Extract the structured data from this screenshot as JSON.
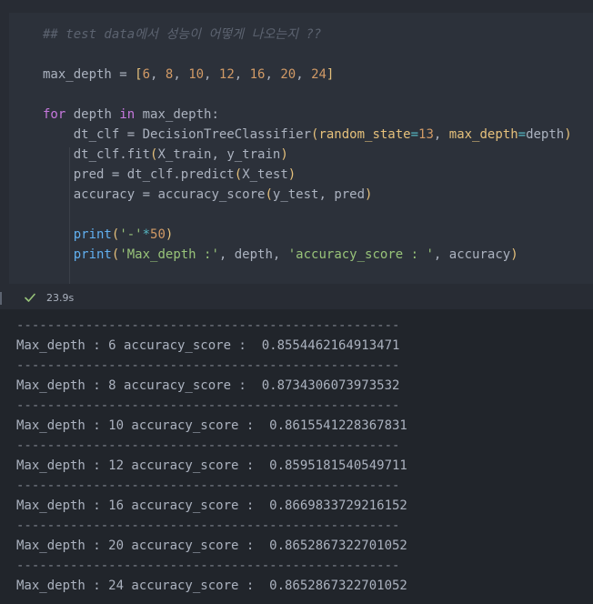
{
  "code": {
    "comment": "## test data에서 성능이 어떻게 나오는지 ??",
    "line_maxdepth": {
      "var": "max_depth",
      "eq": " = ",
      "open": "[",
      "values": [
        "6",
        "8",
        "10",
        "12",
        "16",
        "20",
        "24"
      ],
      "close": "]"
    },
    "line_for": {
      "kw_for": "for",
      "var": " depth ",
      "kw_in": "in",
      "rest": " max_depth:"
    },
    "line_clf": {
      "lhs": "dt_clf = ",
      "fn": "DecisionTreeClassifier",
      "p1": "random_state",
      "v1": "13",
      "p2": "max_depth",
      "v2": "depth"
    },
    "line_fit": {
      "obj": "dt_clf.",
      "fn": "fit",
      "args": "X_train, y_train"
    },
    "line_pred": {
      "lhs": "pred = dt_clf.",
      "fn": "predict",
      "args": "X_test"
    },
    "line_acc": {
      "lhs": "accuracy = ",
      "fn": "accuracy_score",
      "args": "y_test, pred"
    },
    "line_print1": {
      "fn": "print",
      "str": "'-'",
      "op": "*",
      "num": "50"
    },
    "line_print2": {
      "fn": "print",
      "str1": "'Max_depth :'",
      "mid": ", depth, ",
      "str2": "'accuracy_score : '",
      "end": ", accuracy"
    }
  },
  "status": {
    "duration": "23.9s",
    "icon": "check-icon",
    "icon_color": "#98c379"
  },
  "output": {
    "separator": "--------------------------------------------------",
    "results": [
      "Max_depth : 6 accuracy_score :  0.8554462164913471",
      "Max_depth : 8 accuracy_score :  0.8734306073973532",
      "Max_depth : 10 accuracy_score :  0.8615541228367831",
      "Max_depth : 12 accuracy_score :  0.8595181540549711",
      "Max_depth : 16 accuracy_score :  0.8669833729216152",
      "Max_depth : 20 accuracy_score :  0.8652867322701052",
      "Max_depth : 24 accuracy_score :  0.8652867322701052"
    ]
  }
}
